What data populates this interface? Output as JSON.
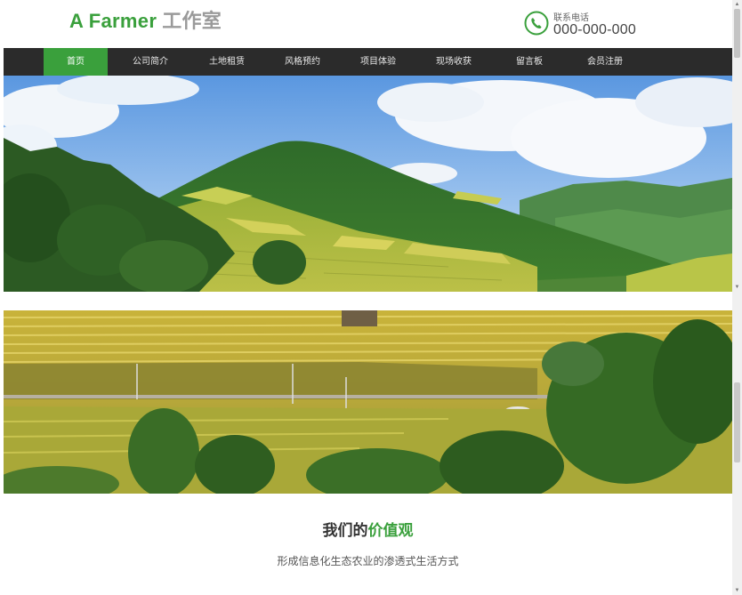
{
  "header": {
    "brand": "A Farmer",
    "studio": "工作室",
    "contact_label": "联系电话",
    "contact_number": "000-000-000"
  },
  "nav": {
    "items": [
      {
        "label": "首页",
        "active": true
      },
      {
        "label": "公司简介",
        "active": false
      },
      {
        "label": "土地租赁",
        "active": false
      },
      {
        "label": "风格预约",
        "active": false
      },
      {
        "label": "项目体验",
        "active": false
      },
      {
        "label": "现场收获",
        "active": false
      },
      {
        "label": "留言板",
        "active": false
      },
      {
        "label": "会员注册",
        "active": false
      }
    ]
  },
  "values": {
    "title_prefix": "我们的",
    "title_highlight": "价值观",
    "subtitle": "形成信息化生态农业的渗透式生活方式"
  },
  "icons": {
    "phone": "phone-icon"
  },
  "colors": {
    "brand_green": "#3aa03c",
    "nav_bg": "#2b2b2b"
  }
}
